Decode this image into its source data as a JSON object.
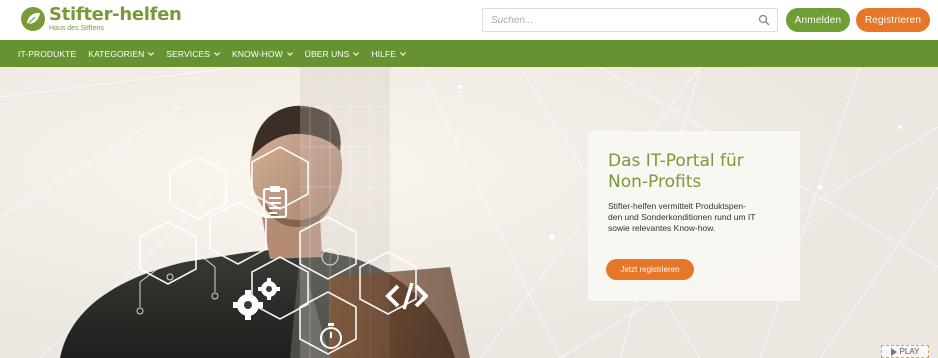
{
  "header": {
    "logo_title": "Stifter-helfen",
    "logo_subtitle": "Haus des Stiftens",
    "search_placeholder": "Suchen...",
    "login_label": "Anmelden",
    "register_label": "Registrieren"
  },
  "nav": {
    "items": [
      {
        "label": "IT-PRODUKTE",
        "has_dropdown": false
      },
      {
        "label": "KATEGORIEN",
        "has_dropdown": true
      },
      {
        "label": "SERVICES",
        "has_dropdown": true
      },
      {
        "label": "KNOW-HOW",
        "has_dropdown": true
      },
      {
        "label": "ÜBER UNS",
        "has_dropdown": true
      },
      {
        "label": "HILFE",
        "has_dropdown": true
      }
    ]
  },
  "hero": {
    "title_line1": "Das IT-Portal für",
    "title_line2": "Non-Profits",
    "text_line1": "Stifter-helfen vermittelt Produktspen-",
    "text_line2": "den und Sonderkonditionen rund um IT",
    "text_line3": "sowie relevantes Know-how.",
    "cta_label": "Jetzt registrieren",
    "play_label": "PLAY",
    "icons": [
      "clipboard-icon",
      "gears-icon",
      "code-icon",
      "stopwatch-icon"
    ]
  },
  "colors": {
    "brand_green": "#679232",
    "logo_green": "#7a9a3a",
    "accent_orange": "#e8762a"
  }
}
